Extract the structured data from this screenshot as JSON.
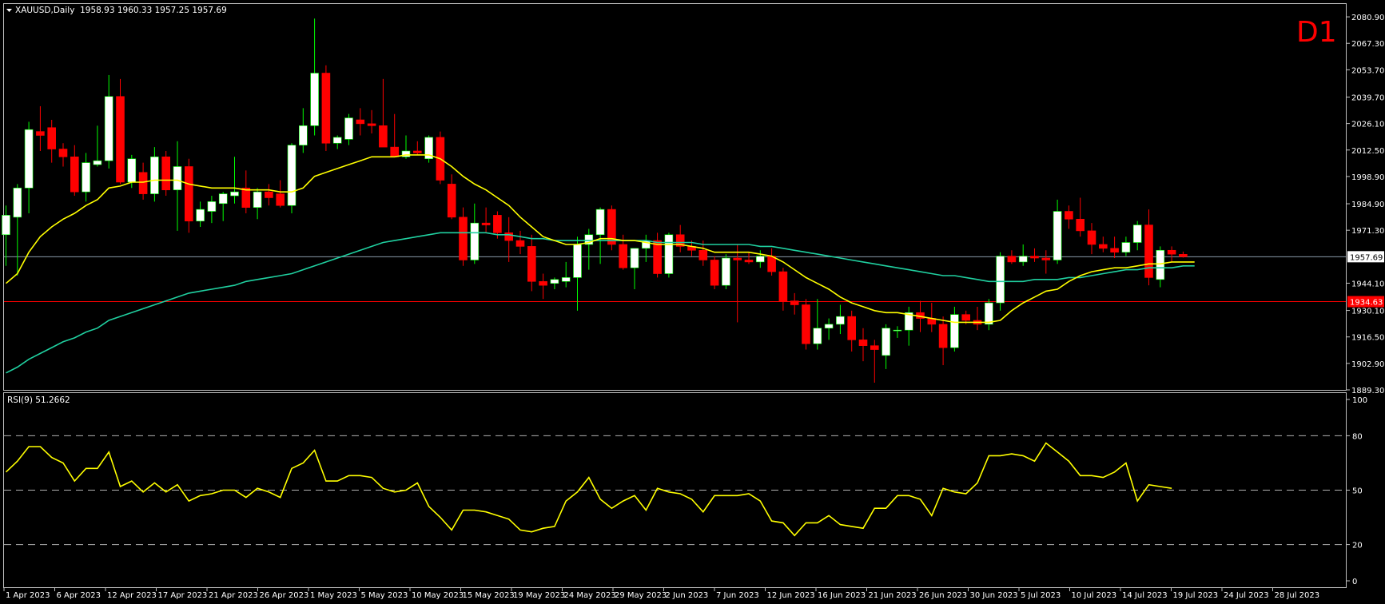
{
  "header": {
    "symbol_line": "XAUUSD,Daily  1958.93 1960.33 1957.25 1957.69",
    "timeframe_badge": "D1"
  },
  "rsi_panel": {
    "label": "RSI(9) 51.2662",
    "axis_ticks": [
      "100",
      "80",
      "50",
      "20",
      "0"
    ]
  },
  "price_axis": {
    "ticks": [
      "2080.90",
      "2067.30",
      "2053.70",
      "2039.70",
      "2026.10",
      "2012.50",
      "1998.90",
      "1984.90",
      "1971.30",
      "1957.69",
      "1944.10",
      "1934.63",
      "1930.10",
      "1916.50",
      "1902.90",
      "1889.30"
    ],
    "current_price": "1957.69",
    "level_price": "1934.63"
  },
  "time_axis": {
    "labels": [
      "1 Apr 2023",
      "6 Apr 2023",
      "12 Apr 2023",
      "17 Apr 2023",
      "21 Apr 2023",
      "26 Apr 2023",
      "1 May 2023",
      "5 May 2023",
      "10 May 2023",
      "15 May 2023",
      "19 May 2023",
      "24 May 2023",
      "29 May 2023",
      "2 Jun 2023",
      "7 Jun 2023",
      "12 Jun 2023",
      "16 Jun 2023",
      "21 Jun 2023",
      "26 Jun 2023",
      "30 Jun 2023",
      "5 Jul 2023",
      "10 Jul 2023",
      "14 Jul 2023",
      "19 Jul 2023",
      "24 Jul 2023",
      "28 Jul 2023"
    ]
  },
  "colors": {
    "background": "#000000",
    "bull_candle": "#ffffff",
    "bear_candle": "#ff0000",
    "ma_fast": "#ffff00",
    "ma_slow": "#20d0a0",
    "rsi_line": "#ffff00",
    "level_line": "#ff0000",
    "price_line": "#8a9aaa",
    "badge": "#ff0000"
  },
  "chart_data": {
    "type": "candlestick",
    "y_range": [
      1889.3,
      2087.5
    ],
    "rsi_range": [
      0,
      100
    ],
    "rsi_levels": [
      80,
      50,
      20
    ],
    "candles": [
      {
        "o": 1969.0,
        "h": 1984.0,
        "l": 1953.0,
        "c": 1979.0
      },
      {
        "o": 1978.0,
        "h": 1995.0,
        "l": 1948.0,
        "c": 1993.0
      },
      {
        "o": 1993.0,
        "h": 2027.0,
        "l": 1980.0,
        "c": 2023.0
      },
      {
        "o": 2022.0,
        "h": 2035.0,
        "l": 2012.0,
        "c": 2020.0
      },
      {
        "o": 2024.0,
        "h": 2028.0,
        "l": 2006.0,
        "c": 2013.0
      },
      {
        "o": 2013.0,
        "h": 2016.0,
        "l": 2004.0,
        "c": 2009.0
      },
      {
        "o": 2009.0,
        "h": 2015.0,
        "l": 1989.0,
        "c": 1991.0
      },
      {
        "o": 1991.0,
        "h": 2011.0,
        "l": 1986.0,
        "c": 2006.0
      },
      {
        "o": 2005.0,
        "h": 2025.0,
        "l": 2004.0,
        "c": 2007.0
      },
      {
        "o": 2007.0,
        "h": 2051.0,
        "l": 2003.0,
        "c": 2040.0
      },
      {
        "o": 2040.0,
        "h": 2049.0,
        "l": 1995.0,
        "c": 1996.0
      },
      {
        "o": 1996.0,
        "h": 2010.0,
        "l": 1993.0,
        "c": 2008.0
      },
      {
        "o": 2001.0,
        "h": 2006.0,
        "l": 1987.0,
        "c": 1990.0
      },
      {
        "o": 1990.0,
        "h": 2014.0,
        "l": 1986.0,
        "c": 2009.0
      },
      {
        "o": 2009.0,
        "h": 2012.0,
        "l": 1989.0,
        "c": 1992.0
      },
      {
        "o": 1992.0,
        "h": 2017.0,
        "l": 1971.0,
        "c": 2004.0
      },
      {
        "o": 2004.0,
        "h": 2008.0,
        "l": 1970.0,
        "c": 1976.0
      },
      {
        "o": 1976.0,
        "h": 1986.0,
        "l": 1973.0,
        "c": 1982.0
      },
      {
        "o": 1981.0,
        "h": 1989.0,
        "l": 1975.0,
        "c": 1986.0
      },
      {
        "o": 1985.0,
        "h": 1991.0,
        "l": 1976.0,
        "c": 1990.0
      },
      {
        "o": 1989.0,
        "h": 2009.0,
        "l": 1985.0,
        "c": 1991.0
      },
      {
        "o": 1993.0,
        "h": 2002.0,
        "l": 1980.0,
        "c": 1983.0
      },
      {
        "o": 1983.0,
        "h": 1993.0,
        "l": 1977.0,
        "c": 1991.0
      },
      {
        "o": 1991.0,
        "h": 1995.0,
        "l": 1984.0,
        "c": 1988.0
      },
      {
        "o": 1990.0,
        "h": 1997.0,
        "l": 1983.0,
        "c": 1984.0
      },
      {
        "o": 1984.0,
        "h": 2016.0,
        "l": 1980.0,
        "c": 2015.0
      },
      {
        "o": 2015.0,
        "h": 2034.0,
        "l": 2011.0,
        "c": 2025.0
      },
      {
        "o": 2025.0,
        "h": 2080.0,
        "l": 2020.0,
        "c": 2052.0
      },
      {
        "o": 2052.0,
        "h": 2056.0,
        "l": 2012.0,
        "c": 2016.0
      },
      {
        "o": 2016.0,
        "h": 2020.0,
        "l": 2013.0,
        "c": 2019.0
      },
      {
        "o": 2018.0,
        "h": 2031.0,
        "l": 2015.0,
        "c": 2029.0
      },
      {
        "o": 2028.0,
        "h": 2034.0,
        "l": 2020.0,
        "c": 2026.0
      },
      {
        "o": 2026.0,
        "h": 2033.0,
        "l": 2021.0,
        "c": 2025.0
      },
      {
        "o": 2025.0,
        "h": 2049.0,
        "l": 2016.0,
        "c": 2014.0
      },
      {
        "o": 2014.0,
        "h": 2031.0,
        "l": 2009.0,
        "c": 2009.0
      },
      {
        "o": 2009.0,
        "h": 2020.0,
        "l": 2008.0,
        "c": 2012.0
      },
      {
        "o": 2012.0,
        "h": 2017.0,
        "l": 2010.0,
        "c": 2011.0
      },
      {
        "o": 2008.0,
        "h": 2020.0,
        "l": 2006.0,
        "c": 2019.0
      },
      {
        "o": 2019.0,
        "h": 2022.0,
        "l": 1995.0,
        "c": 1997.0
      },
      {
        "o": 1995.0,
        "h": 2000.0,
        "l": 1977.0,
        "c": 1978.0
      },
      {
        "o": 1978.0,
        "h": 1983.0,
        "l": 1953.0,
        "c": 1956.0
      },
      {
        "o": 1956.0,
        "h": 1985.0,
        "l": 1954.0,
        "c": 1975.0
      },
      {
        "o": 1975.0,
        "h": 1983.0,
        "l": 1970.0,
        "c": 1974.0
      },
      {
        "o": 1979.0,
        "h": 1981.0,
        "l": 1967.0,
        "c": 1970.0
      },
      {
        "o": 1970.0,
        "h": 1978.0,
        "l": 1955.0,
        "c": 1966.0
      },
      {
        "o": 1966.0,
        "h": 1971.0,
        "l": 1959.0,
        "c": 1963.0
      },
      {
        "o": 1963.0,
        "h": 1969.0,
        "l": 1940.0,
        "c": 1945.0
      },
      {
        "o": 1945.0,
        "h": 1949.0,
        "l": 1936.0,
        "c": 1943.0
      },
      {
        "o": 1944.0,
        "h": 1947.0,
        "l": 1941.0,
        "c": 1946.0
      },
      {
        "o": 1945.0,
        "h": 1955.0,
        "l": 1942.0,
        "c": 1947.0
      },
      {
        "o": 1947.0,
        "h": 1968.0,
        "l": 1930.0,
        "c": 1964.0
      },
      {
        "o": 1964.0,
        "h": 1972.0,
        "l": 1951.0,
        "c": 1969.0
      },
      {
        "o": 1969.0,
        "h": 1983.0,
        "l": 1954.0,
        "c": 1982.0
      },
      {
        "o": 1982.0,
        "h": 1984.0,
        "l": 1961.0,
        "c": 1964.0
      },
      {
        "o": 1964.0,
        "h": 1969.0,
        "l": 1951.0,
        "c": 1952.0
      },
      {
        "o": 1952.0,
        "h": 1960.0,
        "l": 1941.0,
        "c": 1962.0
      },
      {
        "o": 1962.0,
        "h": 1969.0,
        "l": 1955.0,
        "c": 1966.0
      },
      {
        "o": 1966.0,
        "h": 1970.0,
        "l": 1947.0,
        "c": 1949.0
      },
      {
        "o": 1949.0,
        "h": 1970.0,
        "l": 1947.0,
        "c": 1969.0
      },
      {
        "o": 1969.0,
        "h": 1974.0,
        "l": 1960.0,
        "c": 1963.0
      },
      {
        "o": 1963.0,
        "h": 1966.0,
        "l": 1958.0,
        "c": 1961.0
      },
      {
        "o": 1961.0,
        "h": 1966.0,
        "l": 1953.0,
        "c": 1956.0
      },
      {
        "o": 1956.0,
        "h": 1958.0,
        "l": 1941.0,
        "c": 1943.0
      },
      {
        "o": 1943.0,
        "h": 1959.0,
        "l": 1941.0,
        "c": 1957.0
      },
      {
        "o": 1957.0,
        "h": 1964.0,
        "l": 1924.0,
        "c": 1956.0
      },
      {
        "o": 1956.0,
        "h": 1960.0,
        "l": 1954.0,
        "c": 1955.0
      },
      {
        "o": 1955.0,
        "h": 1961.0,
        "l": 1952.0,
        "c": 1958.0
      },
      {
        "o": 1958.0,
        "h": 1962.0,
        "l": 1948.0,
        "c": 1950.0
      },
      {
        "o": 1950.0,
        "h": 1952.0,
        "l": 1930.0,
        "c": 1935.0
      },
      {
        "o": 1935.0,
        "h": 1939.0,
        "l": 1928.0,
        "c": 1933.0
      },
      {
        "o": 1933.0,
        "h": 1936.0,
        "l": 1910.0,
        "c": 1913.0
      },
      {
        "o": 1913.0,
        "h": 1936.0,
        "l": 1910.0,
        "c": 1921.0
      },
      {
        "o": 1921.0,
        "h": 1926.0,
        "l": 1915.0,
        "c": 1923.0
      },
      {
        "o": 1923.0,
        "h": 1933.0,
        "l": 1918.0,
        "c": 1927.0
      },
      {
        "o": 1927.0,
        "h": 1930.0,
        "l": 1909.0,
        "c": 1915.0
      },
      {
        "o": 1915.0,
        "h": 1921.0,
        "l": 1904.0,
        "c": 1912.0
      },
      {
        "o": 1912.0,
        "h": 1915.0,
        "l": 1893.0,
        "c": 1910.0
      },
      {
        "o": 1907.0,
        "h": 1923.0,
        "l": 1900.0,
        "c": 1921.0
      },
      {
        "o": 1920.0,
        "h": 1922.0,
        "l": 1916.0,
        "c": 1920.0
      },
      {
        "o": 1920.0,
        "h": 1932.0,
        "l": 1912.0,
        "c": 1929.0
      },
      {
        "o": 1929.0,
        "h": 1935.0,
        "l": 1919.0,
        "c": 1926.0
      },
      {
        "o": 1926.0,
        "h": 1934.0,
        "l": 1919.0,
        "c": 1923.0
      },
      {
        "o": 1923.0,
        "h": 1927.0,
        "l": 1902.0,
        "c": 1911.0
      },
      {
        "o": 1911.0,
        "h": 1932.0,
        "l": 1909.0,
        "c": 1928.0
      },
      {
        "o": 1928.0,
        "h": 1930.0,
        "l": 1923.0,
        "c": 1925.0
      },
      {
        "o": 1925.0,
        "h": 1932.0,
        "l": 1920.0,
        "c": 1923.0
      },
      {
        "o": 1923.0,
        "h": 1936.0,
        "l": 1920.0,
        "c": 1934.0
      },
      {
        "o": 1934.0,
        "h": 1960.0,
        "l": 1930.0,
        "c": 1958.0
      },
      {
        "o": 1958.0,
        "h": 1961.0,
        "l": 1954.0,
        "c": 1955.0
      },
      {
        "o": 1955.0,
        "h": 1964.0,
        "l": 1953.0,
        "c": 1958.0
      },
      {
        "o": 1958.0,
        "h": 1962.0,
        "l": 1955.0,
        "c": 1957.0
      },
      {
        "o": 1957.0,
        "h": 1961.0,
        "l": 1949.0,
        "c": 1956.0
      },
      {
        "o": 1956.0,
        "h": 1987.0,
        "l": 1954.0,
        "c": 1981.0
      },
      {
        "o": 1981.0,
        "h": 1984.0,
        "l": 1972.0,
        "c": 1977.0
      },
      {
        "o": 1977.0,
        "h": 1988.0,
        "l": 1968.0,
        "c": 1971.0
      },
      {
        "o": 1971.0,
        "h": 1975.0,
        "l": 1959.0,
        "c": 1964.0
      },
      {
        "o": 1964.0,
        "h": 1968.0,
        "l": 1960.0,
        "c": 1962.0
      },
      {
        "o": 1962.0,
        "h": 1968.0,
        "l": 1957.0,
        "c": 1960.0
      },
      {
        "o": 1960.0,
        "h": 1968.0,
        "l": 1958.0,
        "c": 1965.0
      },
      {
        "o": 1965.0,
        "h": 1976.0,
        "l": 1961.0,
        "c": 1974.0
      },
      {
        "o": 1974.0,
        "h": 1982.0,
        "l": 1943.0,
        "c": 1947.0
      },
      {
        "o": 1946.0,
        "h": 1963.0,
        "l": 1942.0,
        "c": 1961.0
      },
      {
        "o": 1961.0,
        "h": 1963.0,
        "l": 1955.0,
        "c": 1959.0
      },
      {
        "o": 1958.93,
        "h": 1960.33,
        "l": 1957.25,
        "c": 1957.69
      }
    ],
    "ma_fast": [
      1944,
      1949,
      1960,
      1968,
      1973,
      1977,
      1980,
      1984,
      1987,
      1993,
      1994,
      1996,
      1996,
      1997,
      1997,
      1997,
      1995,
      1994,
      1993,
      1993,
      1993,
      1992,
      1992,
      1992,
      1991,
      1991,
      1993,
      1999,
      2001,
      2003,
      2005,
      2007,
      2009,
      2009,
      2009,
      2010,
      2010,
      2010,
      2008,
      2004,
      1999,
      1995,
      1992,
      1988,
      1984,
      1978,
      1973,
      1968,
      1966,
      1964,
      1964,
      1965,
      1967,
      1967,
      1966,
      1966,
      1965,
      1964,
      1964,
      1964,
      1963,
      1962,
      1960,
      1960,
      1960,
      1960,
      1959,
      1958,
      1955,
      1951,
      1947,
      1944,
      1941,
      1937,
      1934,
      1932,
      1930,
      1929,
      1929,
      1928,
      1927,
      1926,
      1925,
      1924,
      1924,
      1924,
      1924,
      1925,
      1930,
      1934,
      1937,
      1940,
      1941,
      1945,
      1948,
      1950,
      1951,
      1952,
      1952,
      1953,
      1954,
      1954,
      1955,
      1955,
      1955
    ],
    "ma_slow": [
      1898,
      1901,
      1905,
      1908,
      1911,
      1914,
      1916,
      1919,
      1921,
      1925,
      1927,
      1929,
      1931,
      1933,
      1935,
      1937,
      1939,
      1940,
      1941,
      1942,
      1943,
      1945,
      1946,
      1947,
      1948,
      1949,
      1951,
      1953,
      1955,
      1957,
      1959,
      1961,
      1963,
      1965,
      1966,
      1967,
      1968,
      1969,
      1970,
      1970,
      1970,
      1970,
      1970,
      1969,
      1969,
      1968,
      1967,
      1967,
      1966,
      1966,
      1966,
      1966,
      1966,
      1966,
      1966,
      1966,
      1966,
      1965,
      1965,
      1965,
      1965,
      1964,
      1964,
      1964,
      1964,
      1964,
      1963,
      1963,
      1962,
      1961,
      1960,
      1959,
      1958,
      1957,
      1956,
      1955,
      1954,
      1953,
      1952,
      1951,
      1950,
      1949,
      1948,
      1948,
      1947,
      1946,
      1945,
      1945,
      1945,
      1945,
      1946,
      1946,
      1946,
      1947,
      1947,
      1948,
      1949,
      1950,
      1951,
      1951,
      1952,
      1952,
      1952,
      1953,
      1953
    ],
    "rsi": [
      60,
      66,
      74,
      74,
      68,
      65,
      55,
      62,
      62,
      71,
      52,
      55,
      49,
      54,
      49,
      53,
      44,
      47,
      48,
      50,
      50,
      46,
      51,
      49,
      46,
      62,
      65,
      72,
      55,
      55,
      58,
      58,
      57,
      51,
      49,
      50,
      54,
      41,
      35,
      28,
      39,
      39,
      38,
      36,
      34,
      28,
      27,
      29,
      30,
      44,
      49,
      57,
      45,
      40,
      44,
      47,
      39,
      51,
      49,
      48,
      45,
      38,
      47,
      47,
      47,
      48,
      44,
      33,
      32,
      25,
      32,
      32,
      36,
      31,
      30,
      29,
      40,
      40,
      47,
      47,
      45,
      36,
      51,
      49,
      48,
      54,
      69,
      69,
      70,
      69,
      66,
      76,
      71,
      66,
      58,
      58,
      57,
      60,
      65,
      44,
      53,
      52,
      51
    ]
  }
}
